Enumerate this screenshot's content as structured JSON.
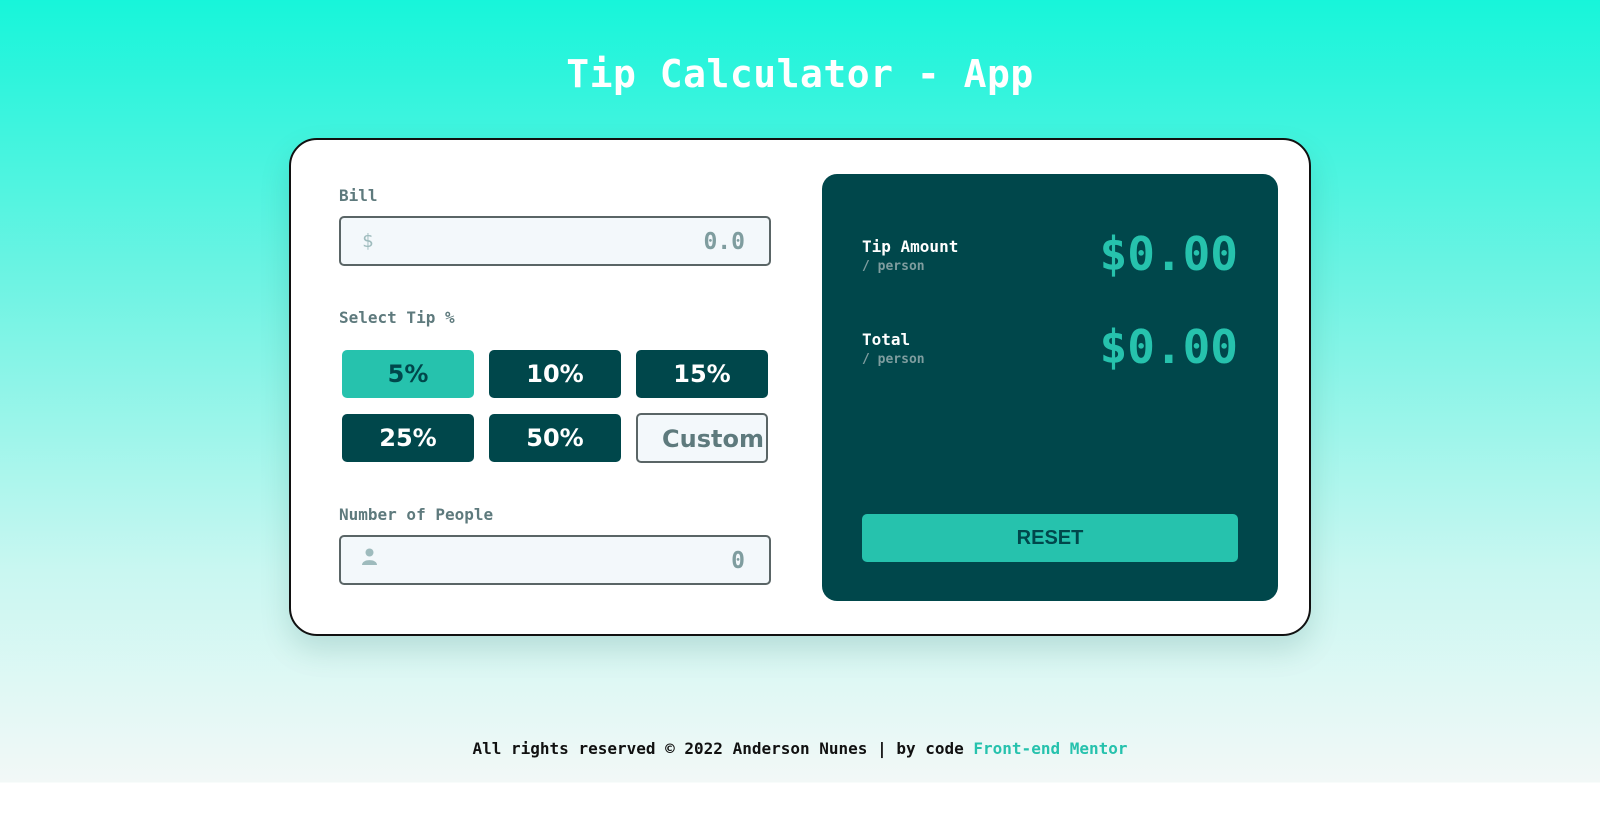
{
  "header": {
    "title": "Tip Calculator - App"
  },
  "bill": {
    "label": "Bill",
    "icon": "dollar-icon",
    "currency_symbol": "$",
    "value": "0.0"
  },
  "tip": {
    "label": "Select Tip %",
    "options": [
      {
        "label": "5%",
        "active": true
      },
      {
        "label": "10%",
        "active": false
      },
      {
        "label": "15%",
        "active": false
      },
      {
        "label": "25%",
        "active": false
      },
      {
        "label": "50%",
        "active": false
      }
    ],
    "custom_placeholder": "Custom"
  },
  "people": {
    "label": "Number of People",
    "icon": "person-icon",
    "value": "0"
  },
  "results": {
    "tip_title": "Tip Amount",
    "tip_sub": "/ person",
    "tip_value": "$0.00",
    "total_title": "Total",
    "total_sub": "/ person",
    "total_value": "$0.00",
    "reset_label": "RESET"
  },
  "footer": {
    "text": "All rights reserved © 2022 Anderson Nunes | by code ",
    "link": "Front-end Mentor"
  },
  "colors": {
    "dark_cyan": "#00474b",
    "strong_cyan": "#26c2ad",
    "grayish_cyan": "#7f9d9f",
    "light_bg": "#f3f8fb"
  }
}
